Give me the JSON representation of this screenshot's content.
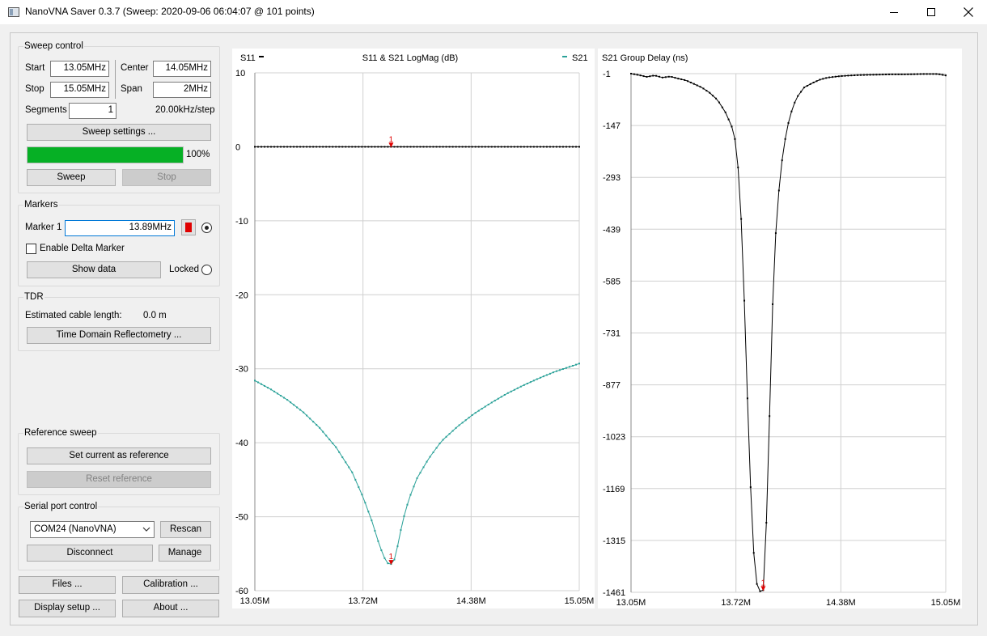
{
  "window": {
    "title": "NanoVNA Saver 0.3.7 (Sweep: 2020-09-06 06:04:07 @ 101 points)"
  },
  "sweep_control": {
    "title": "Sweep control",
    "start_label": "Start",
    "start_value": "13.05MHz",
    "stop_label": "Stop",
    "stop_value": "15.05MHz",
    "center_label": "Center",
    "center_value": "14.05MHz",
    "span_label": "Span",
    "span_value": "2MHz",
    "segments_label": "Segments",
    "segments_value": "1",
    "step_text": "20.00kHz/step",
    "settings_button": "Sweep settings ...",
    "progress_value": 1.0,
    "progress_text": "100%",
    "sweep_button": "Sweep",
    "stop_button": "Stop"
  },
  "markers": {
    "title": "Markers",
    "marker1_label": "Marker 1",
    "marker1_value": "13.89MHz",
    "marker1_color": "#e00000",
    "delta_label": "Enable Delta Marker",
    "show_data_button": "Show data",
    "locked_label": "Locked"
  },
  "tdr": {
    "title": "TDR",
    "cable_label": "Estimated cable length:",
    "cable_value": "0.0 m",
    "tdr_button": "Time Domain Reflectometry ..."
  },
  "reference": {
    "title": "Reference sweep",
    "set_button": "Set current as reference",
    "reset_button": "Reset reference"
  },
  "serial": {
    "title": "Serial port control",
    "port_value": "COM24 (NanoVNA)",
    "rescan_button": "Rescan",
    "disconnect_button": "Disconnect",
    "manage_button": "Manage"
  },
  "bottom_buttons": {
    "files": "Files ...",
    "calibration": "Calibration ...",
    "display_setup": "Display setup ...",
    "about": "About ..."
  },
  "chart_data": [
    {
      "type": "line",
      "title": "S11 & S21 LogMag (dB)",
      "legend_left": "S11",
      "legend_right": "S21",
      "x_ticks": [
        "13.05M",
        "13.72M",
        "14.38M",
        "15.05M"
      ],
      "y_ticks": [
        "10",
        "0",
        "-10",
        "-20",
        "-30",
        "-40",
        "-50",
        "-60"
      ],
      "xlim": [
        13.05,
        15.05
      ],
      "ylim": [
        -60,
        10
      ],
      "grid": true,
      "marker": {
        "label": "1",
        "x": 13.89
      },
      "series": [
        {
          "name": "S11",
          "color": "#000000",
          "x": [
            13.05,
            15.05
          ],
          "y": [
            0,
            0
          ]
        },
        {
          "name": "S21",
          "color": "#2aa198",
          "x": [
            13.05,
            13.15,
            13.25,
            13.35,
            13.45,
            13.55,
            13.65,
            13.72,
            13.77,
            13.82,
            13.85,
            13.87,
            13.89,
            13.91,
            13.93,
            13.96,
            14.0,
            14.05,
            14.12,
            14.2,
            14.3,
            14.4,
            14.5,
            14.6,
            14.7,
            14.8,
            14.9,
            15.05
          ],
          "y": [
            -31.6,
            -32.8,
            -34.2,
            -35.9,
            -38.0,
            -40.6,
            -44.0,
            -47.5,
            -50.5,
            -54.0,
            -55.6,
            -56.3,
            -56.4,
            -55.8,
            -54.0,
            -50.7,
            -47.6,
            -44.8,
            -42.2,
            -39.8,
            -37.8,
            -36.1,
            -34.7,
            -33.4,
            -32.3,
            -31.3,
            -30.4,
            -29.3
          ]
        }
      ]
    },
    {
      "type": "line",
      "title": "S21 Group Delay (ns)",
      "x_ticks": [
        "13.05M",
        "13.72M",
        "14.38M",
        "15.05M"
      ],
      "y_ticks": [
        "-1",
        "-147",
        "-293",
        "-439",
        "-585",
        "-731",
        "-877",
        "-1023",
        "-1169",
        "-1315",
        "-1461"
      ],
      "xlim": [
        13.05,
        15.05
      ],
      "ylim": [
        -1461,
        -1
      ],
      "grid": true,
      "marker": {
        "label": "1",
        "x": 13.89
      },
      "series": [
        {
          "name": "S21",
          "color": "#000000",
          "x": [
            13.05,
            13.1,
            13.15,
            13.2,
            13.25,
            13.3,
            13.35,
            13.4,
            13.45,
            13.5,
            13.55,
            13.6,
            13.65,
            13.68,
            13.7,
            13.72,
            13.74,
            13.76,
            13.78,
            13.8,
            13.82,
            13.84,
            13.86,
            13.88,
            13.89,
            13.9,
            13.92,
            13.94,
            13.96,
            13.98,
            14.0,
            14.02,
            14.04,
            14.06,
            14.08,
            14.1,
            14.15,
            14.2,
            14.25,
            14.3,
            14.38,
            14.45,
            14.5,
            14.6,
            14.7,
            14.8,
            14.9,
            15.0,
            15.05
          ],
          "y": [
            -1,
            -5,
            -10,
            -6,
            -12,
            -9,
            -15,
            -20,
            -30,
            -40,
            -55,
            -75,
            -110,
            -140,
            -160,
            -210,
            -320,
            -500,
            -780,
            -1050,
            -1280,
            -1420,
            -1455,
            -1461,
            -1455,
            -1380,
            -1150,
            -780,
            -520,
            -380,
            -280,
            -210,
            -160,
            -120,
            -95,
            -70,
            -40,
            -28,
            -18,
            -12,
            -8,
            -6,
            -5,
            -4,
            -3,
            -3,
            -2,
            -2,
            -6
          ]
        }
      ]
    }
  ]
}
